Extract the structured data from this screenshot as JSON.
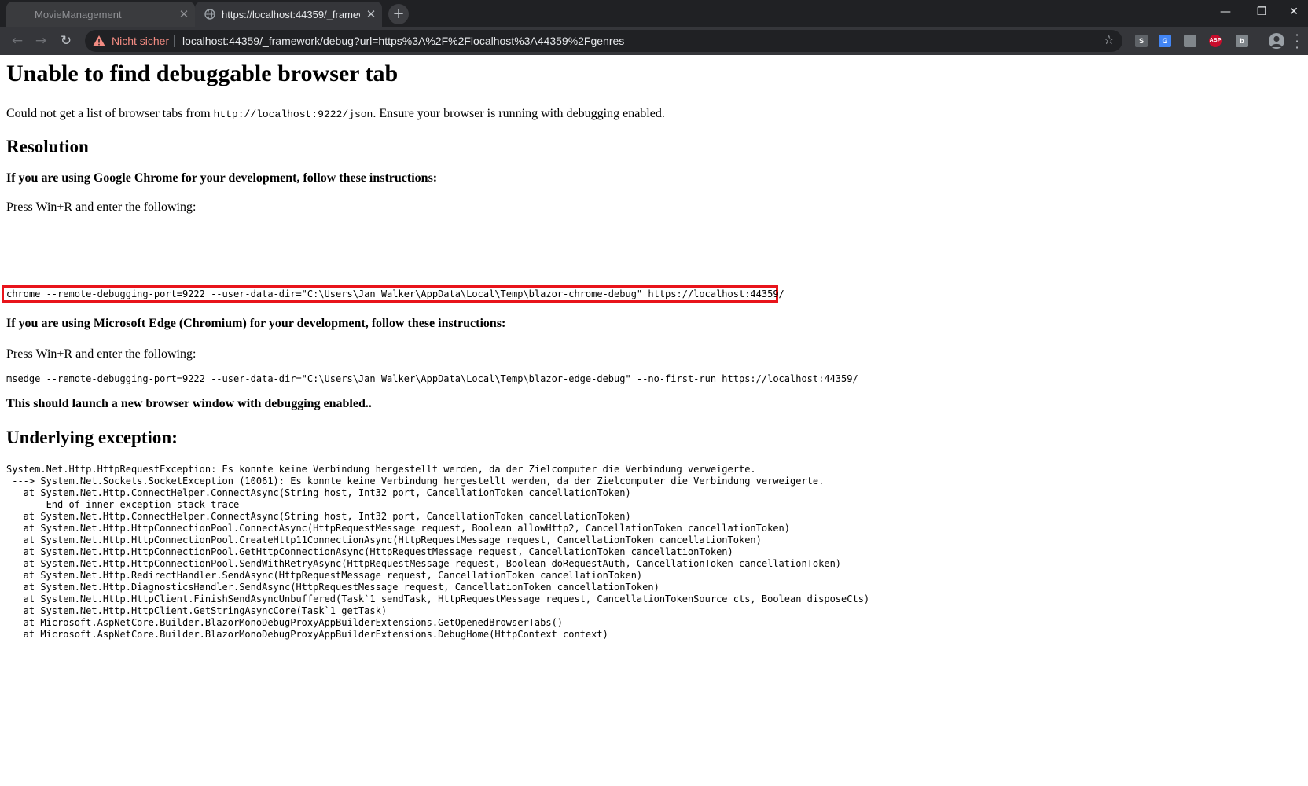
{
  "browser": {
    "tabs": [
      {
        "label": "MovieManagement",
        "active": false
      },
      {
        "label": "https://localhost:44359/_framewo",
        "active": true
      }
    ],
    "new_tab_icon": "plus-icon",
    "window_controls": {
      "minimize": "—",
      "restore": "❐",
      "close": "✕"
    },
    "nav": {
      "back": "←",
      "forward": "→",
      "reload": "↻"
    },
    "omnibox": {
      "security_label": "Nicht sicher",
      "url": "localhost:44359/_framework/debug?url=https%3A%2F%2Flocalhost%3A44359%2Fgenres",
      "bookmark_icon": "star-icon"
    },
    "extensions": [
      {
        "name": "s-extension-icon",
        "glyph": "S",
        "color": "#5f6368"
      },
      {
        "name": "translate-icon",
        "glyph": "G",
        "color": "#4285f4"
      },
      {
        "name": "extension-grey-icon",
        "glyph": "",
        "color": "#80868b"
      },
      {
        "name": "adblock-plus-icon",
        "glyph": "ABP",
        "color": "#c70d2c"
      },
      {
        "name": "extension-puzzle-icon",
        "glyph": "b",
        "color": "#80868b"
      }
    ],
    "accent_warning_color": "#f28b82"
  },
  "page": {
    "title": "Unable to find debuggable browser tab",
    "intro": {
      "before": "Could not get a list of browser tabs from ",
      "code": "http://localhost:9222/json",
      "after": ". Ensure your browser is running with debugging enabled."
    },
    "resolution_heading": "Resolution",
    "chrome_heading": "If you are using Google Chrome for your development, follow these instructions:",
    "chrome_press": "Press Win+R and enter the following:",
    "chrome_command": "chrome --remote-debugging-port=9222 --user-data-dir=\"C:\\Users\\Jan Walker\\AppData\\Local\\Temp\\blazor-chrome-debug\" https://localhost:44359/",
    "edge_heading": "If you are using Microsoft Edge (Chromium) for your development, follow these instructions:",
    "edge_press": "Press Win+R and enter the following:",
    "edge_command": "msedge --remote-debugging-port=9222 --user-data-dir=\"C:\\Users\\Jan Walker\\AppData\\Local\\Temp\\blazor-edge-debug\" --no-first-run https://localhost:44359/",
    "launch_note": "This should launch a new browser window with debugging enabled..",
    "exception_heading": "Underlying exception:",
    "exception_text": "System.Net.Http.HttpRequestException: Es konnte keine Verbindung hergestellt werden, da der Zielcomputer die Verbindung verweigerte.\n ---> System.Net.Sockets.SocketException (10061): Es konnte keine Verbindung hergestellt werden, da der Zielcomputer die Verbindung verweigerte.\n   at System.Net.Http.ConnectHelper.ConnectAsync(String host, Int32 port, CancellationToken cancellationToken)\n   --- End of inner exception stack trace ---\n   at System.Net.Http.ConnectHelper.ConnectAsync(String host, Int32 port, CancellationToken cancellationToken)\n   at System.Net.Http.HttpConnectionPool.ConnectAsync(HttpRequestMessage request, Boolean allowHttp2, CancellationToken cancellationToken)\n   at System.Net.Http.HttpConnectionPool.CreateHttp11ConnectionAsync(HttpRequestMessage request, CancellationToken cancellationToken)\n   at System.Net.Http.HttpConnectionPool.GetHttpConnectionAsync(HttpRequestMessage request, CancellationToken cancellationToken)\n   at System.Net.Http.HttpConnectionPool.SendWithRetryAsync(HttpRequestMessage request, Boolean doRequestAuth, CancellationToken cancellationToken)\n   at System.Net.Http.RedirectHandler.SendAsync(HttpRequestMessage request, CancellationToken cancellationToken)\n   at System.Net.Http.DiagnosticsHandler.SendAsync(HttpRequestMessage request, CancellationToken cancellationToken)\n   at System.Net.Http.HttpClient.FinishSendAsyncUnbuffered(Task`1 sendTask, HttpRequestMessage request, CancellationTokenSource cts, Boolean disposeCts)\n   at System.Net.Http.HttpClient.GetStringAsyncCore(Task`1 getTask)\n   at Microsoft.AspNetCore.Builder.BlazorMonoDebugProxyAppBuilderExtensions.GetOpenedBrowserTabs()\n   at Microsoft.AspNetCore.Builder.BlazorMonoDebugProxyAppBuilderExtensions.DebugHome(HttpContext context)",
    "highlight_color": "#e8141b"
  }
}
